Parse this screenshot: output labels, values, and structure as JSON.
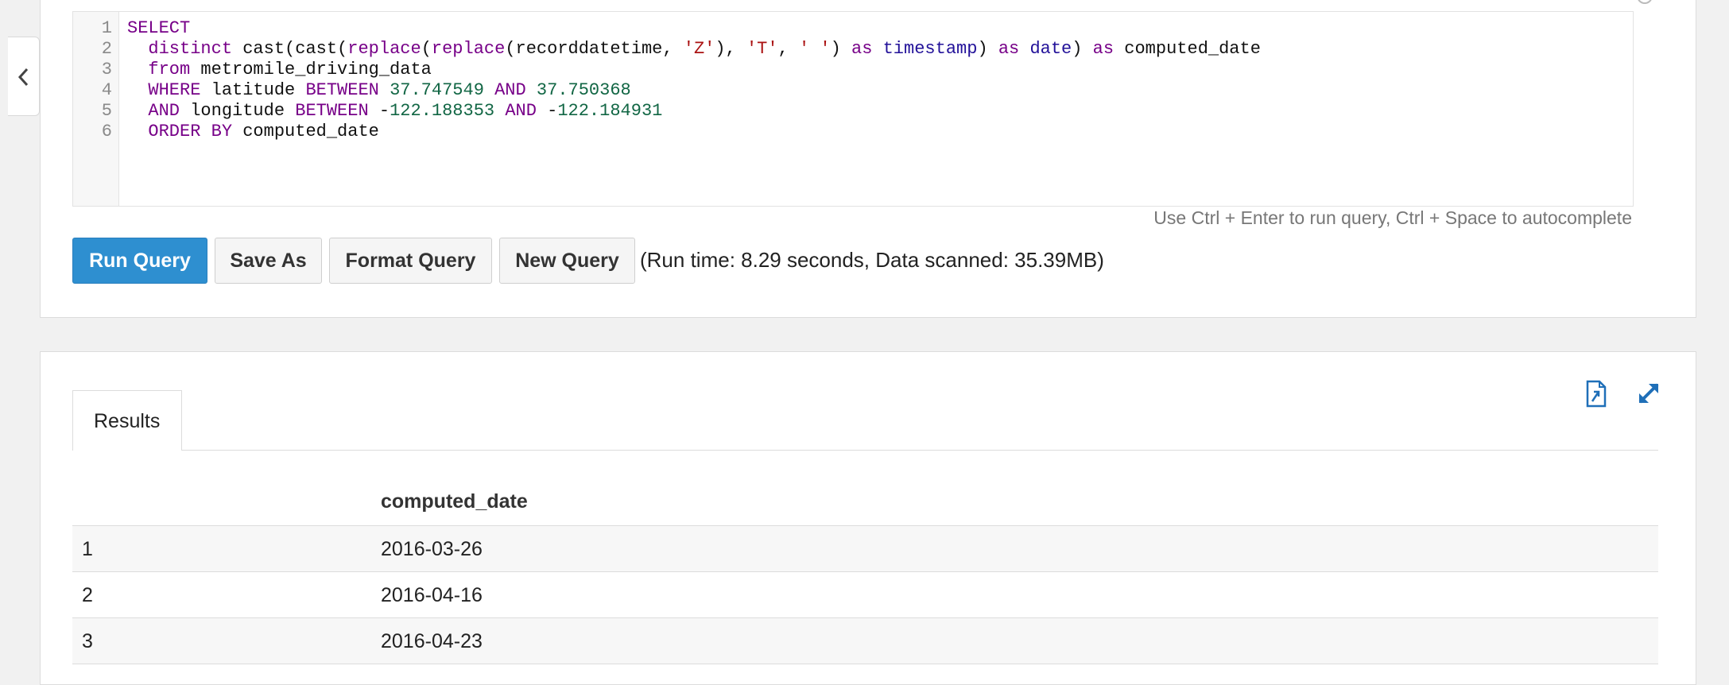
{
  "editor": {
    "line_numbers": [
      "1",
      "2",
      "3",
      "4",
      "5",
      "6"
    ],
    "lines": [
      [
        {
          "t": "SELECT",
          "c": "kw"
        }
      ],
      [
        {
          "t": "  ",
          "c": "id"
        },
        {
          "t": "distinct",
          "c": "kw"
        },
        {
          "t": " cast(cast(",
          "c": "id"
        },
        {
          "t": "replace",
          "c": "fn"
        },
        {
          "t": "(",
          "c": "id"
        },
        {
          "t": "replace",
          "c": "fn"
        },
        {
          "t": "(recorddatetime, ",
          "c": "id"
        },
        {
          "t": "'Z'",
          "c": "str"
        },
        {
          "t": "), ",
          "c": "id"
        },
        {
          "t": "'T'",
          "c": "str"
        },
        {
          "t": ", ",
          "c": "id"
        },
        {
          "t": "' '",
          "c": "str"
        },
        {
          "t": ") ",
          "c": "id"
        },
        {
          "t": "as",
          "c": "kw"
        },
        {
          "t": " ",
          "c": "id"
        },
        {
          "t": "timestamp",
          "c": "ty"
        },
        {
          "t": ") ",
          "c": "id"
        },
        {
          "t": "as",
          "c": "kw"
        },
        {
          "t": " ",
          "c": "id"
        },
        {
          "t": "date",
          "c": "ty"
        },
        {
          "t": ") ",
          "c": "id"
        },
        {
          "t": "as",
          "c": "kw"
        },
        {
          "t": " computed_date",
          "c": "id"
        }
      ],
      [
        {
          "t": "  ",
          "c": "id"
        },
        {
          "t": "from",
          "c": "kw"
        },
        {
          "t": " metromile_driving_data",
          "c": "id"
        }
      ],
      [
        {
          "t": "  ",
          "c": "id"
        },
        {
          "t": "WHERE",
          "c": "kw"
        },
        {
          "t": " latitude ",
          "c": "id"
        },
        {
          "t": "BETWEEN",
          "c": "kw"
        },
        {
          "t": " ",
          "c": "id"
        },
        {
          "t": "37.747549",
          "c": "num"
        },
        {
          "t": " ",
          "c": "id"
        },
        {
          "t": "AND",
          "c": "kw"
        },
        {
          "t": " ",
          "c": "id"
        },
        {
          "t": "37.750368",
          "c": "num"
        }
      ],
      [
        {
          "t": "  ",
          "c": "id"
        },
        {
          "t": "AND",
          "c": "kw"
        },
        {
          "t": " longitude ",
          "c": "id"
        },
        {
          "t": "BETWEEN",
          "c": "kw"
        },
        {
          "t": " -",
          "c": "id"
        },
        {
          "t": "122.188353",
          "c": "num"
        },
        {
          "t": " ",
          "c": "id"
        },
        {
          "t": "AND",
          "c": "kw"
        },
        {
          "t": " -",
          "c": "id"
        },
        {
          "t": "122.184931",
          "c": "num"
        }
      ],
      [
        {
          "t": "  ",
          "c": "id"
        },
        {
          "t": "ORDER BY",
          "c": "kw"
        },
        {
          "t": " computed_date",
          "c": "id"
        }
      ]
    ],
    "hint": "Use Ctrl + Enter to run query, Ctrl + Space to autocomplete"
  },
  "toolbar": {
    "run_label": "Run Query",
    "save_label": "Save As",
    "format_label": "Format Query",
    "new_label": "New Query",
    "run_info": "(Run time: 8.29 seconds, Data scanned: 35.39MB)"
  },
  "results": {
    "tab_label": "Results",
    "column_header": "computed_date",
    "rows": [
      {
        "index": "1",
        "value": "2016-03-26"
      },
      {
        "index": "2",
        "value": "2016-04-16"
      },
      {
        "index": "3",
        "value": "2016-04-23"
      }
    ]
  },
  "icons": {
    "collapse": "chevron-left-icon",
    "download": "download-file-icon",
    "expand": "expand-icon"
  },
  "colors": {
    "primary": "#2e8fd0",
    "icon_blue": "#1f6fb8"
  }
}
